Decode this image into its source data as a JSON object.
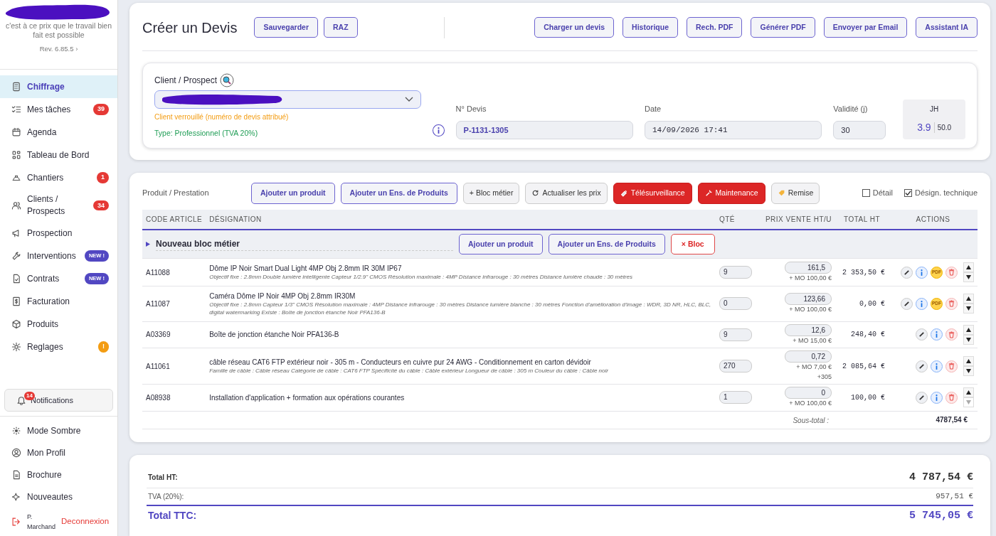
{
  "sidebar": {
    "tagline": "c'est à ce prix que le travail bien fait est possible",
    "revision": "Rev. 6.85.5 ›",
    "items": [
      {
        "label": "Chiffrage",
        "selected": true
      },
      {
        "label": "Mes tâches",
        "selected": false,
        "badge": "39",
        "kind": "count"
      },
      {
        "label": "Agenda",
        "selected": false
      },
      {
        "label": "Tableau de Bord",
        "selected": false
      },
      {
        "label": "Chantiers",
        "selected": false,
        "badge": "1",
        "kind": "count"
      },
      {
        "label": "Clients / Prospects",
        "selected": false,
        "badge": "34",
        "kind": "count"
      },
      {
        "label": "Prospection",
        "selected": false
      },
      {
        "label": "Interventions",
        "selected": false,
        "badge": "NEW !",
        "kind": "new"
      },
      {
        "label": "Contrats",
        "selected": false,
        "badge": "NEW !",
        "kind": "new"
      },
      {
        "label": "Facturation",
        "selected": false
      },
      {
        "label": "Produits",
        "selected": false
      },
      {
        "label": "Reglages",
        "selected": false,
        "badge": "!",
        "kind": "warning"
      }
    ],
    "notifications": {
      "label": "Notifications",
      "count": "14"
    },
    "footer": [
      {
        "label": "Mode Sombre"
      },
      {
        "label": "Mon Profil"
      },
      {
        "label": "Brochure"
      },
      {
        "label": "Nouveautes"
      }
    ],
    "user": "P. Marchand",
    "logout": "Deconnexion"
  },
  "header": {
    "title": "Créer un Devis",
    "left_buttons": [
      "Sauvegarder",
      "RAZ"
    ],
    "right_buttons": [
      "Charger un devis",
      "Historique",
      "Rech. PDF",
      "Générer PDF",
      "Envoyer par Email",
      "Assistant IA"
    ]
  },
  "client": {
    "label": "Client / Prospect",
    "locked_note": "Client verrouillé (numéro de devis attribué)",
    "type": "Type: Professionnel (TVA 20%)",
    "quote_label": "N° Devis",
    "quote_value": "P-1131-1305",
    "date_label": "Date",
    "date_value": "14/09/2026 17:41",
    "validity_label": "Validité (j)",
    "validity_value": "30",
    "jh_label": "JH",
    "jh_value": "3.9",
    "jh_max": "50.0"
  },
  "products": {
    "title": "Produit / Prestation",
    "toolbar": [
      {
        "label": "Ajouter un produit",
        "kind": "outline"
      },
      {
        "label": "Ajouter un Ens. de Produits",
        "kind": "outline"
      },
      {
        "label": "+ Bloc métier",
        "kind": "light"
      },
      {
        "label": "Actualiser les prix",
        "kind": "light-refresh"
      },
      {
        "label": "Télésurveillance",
        "kind": "danger-camera"
      },
      {
        "label": "Maintenance",
        "kind": "danger-wrench"
      },
      {
        "label": "Remise",
        "kind": "light-tag"
      }
    ],
    "checkboxes": [
      {
        "label": "Détail",
        "checked": false
      },
      {
        "label": "Désign. technique",
        "checked": true
      }
    ],
    "columns": [
      "CODE ARTICLE",
      "DÉSIGNATION",
      "QTÉ",
      "PRIX VENTE HT/U",
      "TOTAL HT",
      "ACTIONS"
    ],
    "block": {
      "title": "Nouveau bloc métier",
      "buttons": [
        {
          "label": "Ajouter un produit",
          "kind": "outline"
        },
        {
          "label": "Ajouter un Ens. de Produits",
          "kind": "outline"
        },
        {
          "label": "× Bloc",
          "kind": "remove"
        }
      ]
    },
    "rows": [
      {
        "code": "A11088",
        "name": "Dôme IP Noir Smart Dual Light 4MP Obj 2.8mm IR 30M IP67",
        "desc": "Objectif fixe : 2.8mm Double lumière intelligente Capteur 1/2.9\" CMOS Résolution maximale : 4MP Distance infrarouge : 30 mètres Distance lumière chaude : 30 mètres",
        "qty": "9",
        "price": "161,5",
        "labor": "+ MO 100,00 €",
        "total": "2 353,50 €",
        "pdf_label": "PDF",
        "down_disabled": false
      },
      {
        "code": "A11087",
        "name": "Caméra Dôme IP Noir 4MP Obj 2.8mm IR30M",
        "desc": "Objectif fixe : 2.8mm Capteur 1/3\" CMOS Résolution maximale : 4MP Distance infrarouge : 30 mètres Distance lumière blanche : 30 mètres Fonction d'amélioration d'image : WDR, 3D NR, HLC, BLC, digital watermarking Existe : Boîte de jonction étanche Noir PFA136-B",
        "qty": "0",
        "price": "123,66",
        "labor": "+ MO 100,00 €",
        "total": "0,00 €",
        "pdf_label": "PDF",
        "down_disabled": false
      },
      {
        "code": "A03369",
        "name": "Boîte de jonction étanche Noir PFA136-B",
        "qty": "9",
        "price": "12,6",
        "labor": "+ MO 15,00 €",
        "total": "248,40 €",
        "down_disabled": false
      },
      {
        "code": "A11061",
        "name": "câble réseau CAT6 FTP extérieur noir - 305 m - Conducteurs en cuivre pur 24 AWG - Conditionnement en carton dévidoir",
        "desc": "Famille de câble : Câble réseau Catégorie de câble : CAT6 FTP Spécificité du câble : Câble extérieur Longueur de câble : 305 m Couleur du câble : Câble noir",
        "qty": "270",
        "price": "0,72",
        "labor": "+ MO 7,00 €",
        "extra": "+305",
        "total": "2 085,64 €",
        "down_disabled": false
      },
      {
        "code": "A08938",
        "name": "Installation d'application + formation aux opérations courantes",
        "qty": "1",
        "price": "0",
        "labor": "+ MO 100,00 €",
        "total": "100,00 €",
        "down_disabled": true
      }
    ],
    "subtotal_label": "Sous-total :",
    "subtotal_value": "4787,54 €"
  },
  "totals": [
    {
      "label": "Total HT:",
      "value": "4 787,54 €",
      "kind": "ht"
    },
    {
      "label": "TVA (20%):",
      "value": "957,51 €",
      "kind": "tva"
    },
    {
      "label": "Total TTC:",
      "value": "5 745,05 €",
      "kind": "ttc"
    }
  ]
}
